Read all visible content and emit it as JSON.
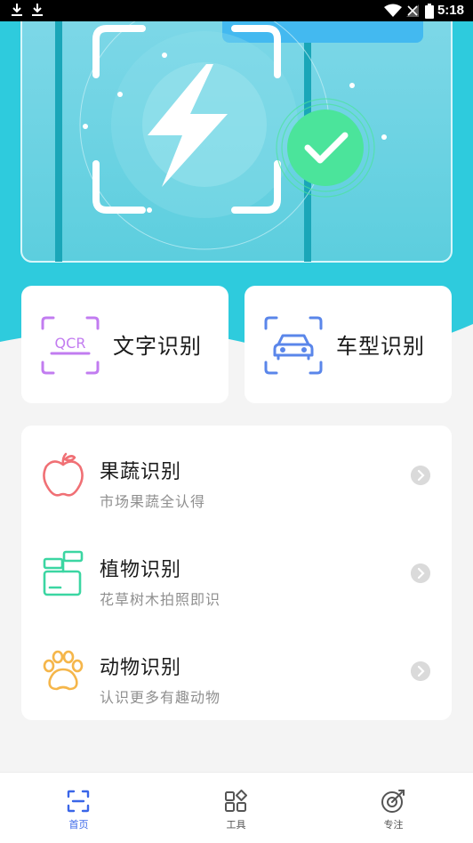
{
  "status_bar": {
    "time": "5:18"
  },
  "top_cards": [
    {
      "label": "文字识别",
      "icon": "ocr-scan-icon",
      "icon_text": "QCR",
      "color": "#c27cf0"
    },
    {
      "label": "车型识别",
      "icon": "car-scan-icon",
      "color": "#5a86ea"
    }
  ],
  "list": [
    {
      "title": "果蔬识别",
      "subtitle": "市场果蔬全认得",
      "icon": "apple-icon",
      "color": "#f07075"
    },
    {
      "title": "植物识别",
      "subtitle": "花草树木拍照即识",
      "icon": "plant-pot-icon",
      "color": "#3bd6a2"
    },
    {
      "title": "动物识别",
      "subtitle": "认识更多有趣动物",
      "icon": "paw-icon",
      "color": "#f5b64a"
    }
  ],
  "bottom_nav": [
    {
      "label": "首页",
      "icon": "scan-home-icon",
      "active": true
    },
    {
      "label": "工具",
      "icon": "tools-grid-icon",
      "active": false
    },
    {
      "label": "专注",
      "icon": "target-icon",
      "active": false
    }
  ],
  "colors": {
    "hero": "#2ecbdd",
    "accent": "#3a66e8",
    "check": "#4be49b"
  }
}
